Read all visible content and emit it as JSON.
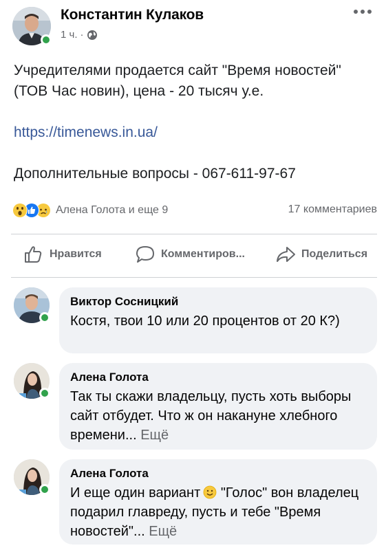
{
  "post": {
    "author": "Константин Кулаков",
    "time": "1 ч.",
    "dot": "·",
    "text_line1": "Учредителями продается сайт \"Время новостей\" (ТОВ Час новин), цена - 20 тысяч у.е.",
    "link": "https://timenews.in.ua/",
    "text_line2": "Дополнительные вопросы - 067-611-97-67"
  },
  "reactions": {
    "icons": [
      "wow-icon",
      "like-icon",
      "sad-icon"
    ],
    "reactors": "Алена Голота и еще 9",
    "comments": "17 комментариев"
  },
  "actions": {
    "like": "Нравится",
    "comment": "Комментиров...",
    "share": "Поделиться"
  },
  "comments": [
    {
      "author": "Виктор Сосницкий",
      "text": "Костя, твои 10 или 20 процентов от 20 К?)"
    },
    {
      "author": "Алена Голота",
      "text": "Так ты скажи владельцу, пусть хоть выборы сайт отбудет. Что ж он накануне хлебного времени...",
      "see_more": "Ещё"
    },
    {
      "author": "Алена Голота",
      "text_before": "И еще один вариант",
      "text_after": "\"Голос\" вон владелец подарил главреду, пусть и тебе \"Время новостей\"...",
      "see_more": "Ещё"
    }
  ],
  "colors": {
    "online": "#31a24c",
    "link": "#385898",
    "bubble": "#f0f2f5",
    "secondary_text": "#65676b"
  }
}
